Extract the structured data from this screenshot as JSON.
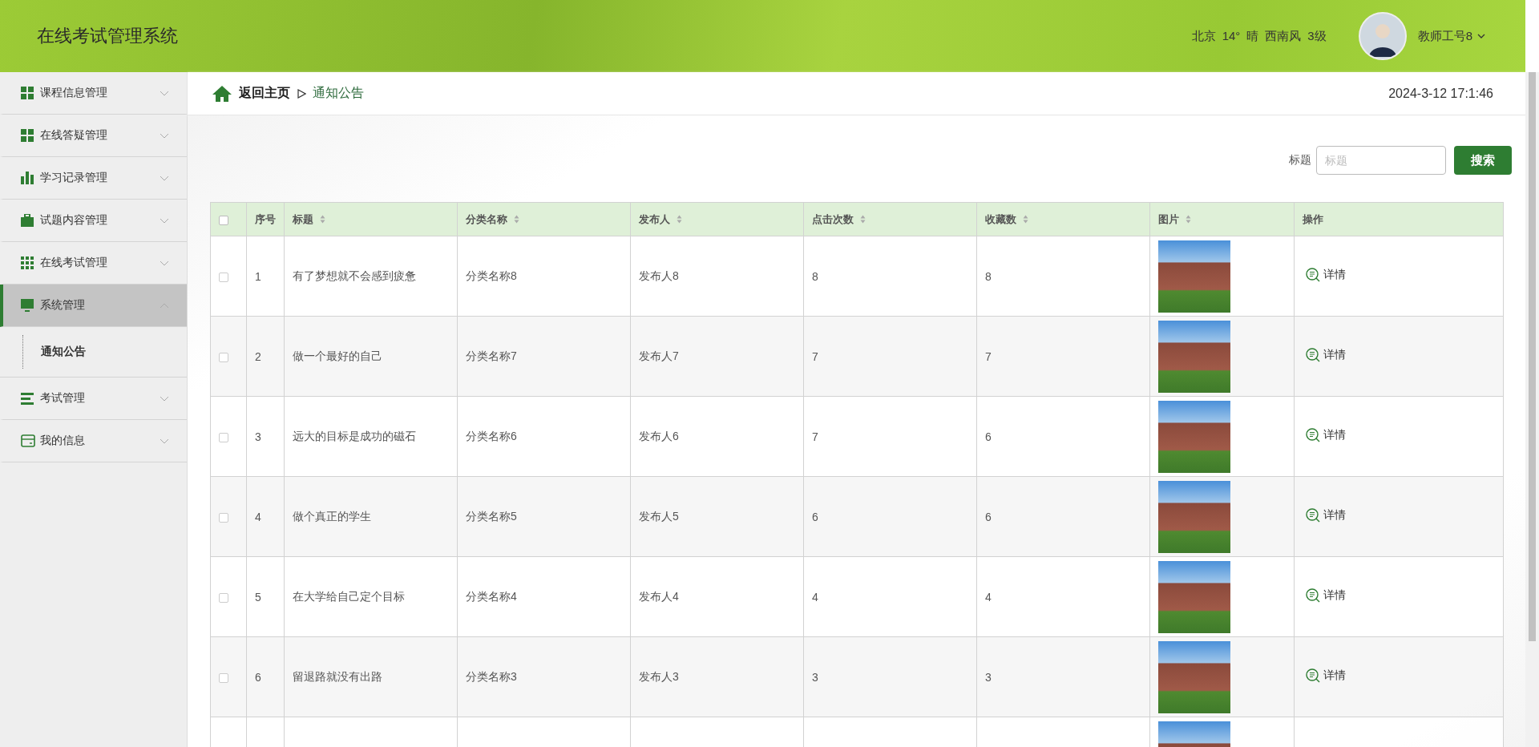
{
  "header": {
    "title": "在线考试管理系统",
    "weather": [
      "北京",
      "14°",
      "晴",
      "西南风",
      "3级"
    ],
    "user": "教师工号8"
  },
  "sidebar": {
    "items": [
      {
        "label": "课程信息管理",
        "expanded": false,
        "selected": false
      },
      {
        "label": "在线答疑管理",
        "expanded": false,
        "selected": false
      },
      {
        "label": "学习记录管理",
        "expanded": false,
        "selected": false
      },
      {
        "label": "试题内容管理",
        "expanded": false,
        "selected": false
      },
      {
        "label": "在线考试管理",
        "expanded": false,
        "selected": false
      },
      {
        "label": "系统管理",
        "expanded": true,
        "selected": true,
        "children": [
          {
            "label": "通知公告",
            "selected": true
          }
        ]
      },
      {
        "label": "考试管理",
        "expanded": false,
        "selected": false
      },
      {
        "label": "我的信息",
        "expanded": false,
        "selected": false
      }
    ]
  },
  "breadcrumb": {
    "home": "返回主页",
    "current": "通知公告"
  },
  "datetime": "2024-3-12 17:1:46",
  "search": {
    "label": "标题",
    "placeholder": "标题",
    "button": "搜索"
  },
  "table": {
    "columns": [
      {
        "label": "序号",
        "sortable": false
      },
      {
        "label": "标题",
        "sortable": true
      },
      {
        "label": "分类名称",
        "sortable": true
      },
      {
        "label": "发布人",
        "sortable": true
      },
      {
        "label": "点击次数",
        "sortable": true
      },
      {
        "label": "收藏数",
        "sortable": true
      },
      {
        "label": "图片",
        "sortable": true
      },
      {
        "label": "操作",
        "sortable": false
      }
    ],
    "header_checked": false,
    "rows": [
      {
        "checked": false,
        "no": "1",
        "title": "有了梦想就不会感到疲惫",
        "category": "分类名称8",
        "publisher": "发布人8",
        "clicks": "8",
        "favorites": "8",
        "action": "详情"
      },
      {
        "checked": false,
        "no": "2",
        "title": "做一个最好的自己",
        "category": "分类名称7",
        "publisher": "发布人7",
        "clicks": "7",
        "favorites": "7",
        "action": "详情"
      },
      {
        "checked": false,
        "no": "3",
        "title": "远大的目标是成功的磁石",
        "category": "分类名称6",
        "publisher": "发布人6",
        "clicks": "7",
        "favorites": "6",
        "action": "详情"
      },
      {
        "checked": false,
        "no": "4",
        "title": "做个真正的学生",
        "category": "分类名称5",
        "publisher": "发布人5",
        "clicks": "6",
        "favorites": "6",
        "action": "详情"
      },
      {
        "checked": false,
        "no": "5",
        "title": "在大学给自己定个目标",
        "category": "分类名称4",
        "publisher": "发布人4",
        "clicks": "4",
        "favorites": "4",
        "action": "详情"
      },
      {
        "checked": false,
        "no": "6",
        "title": "留退路就没有出路",
        "category": "分类名称3",
        "publisher": "发布人3",
        "clicks": "3",
        "favorites": "3",
        "action": "详情"
      },
      {}
    ]
  }
}
